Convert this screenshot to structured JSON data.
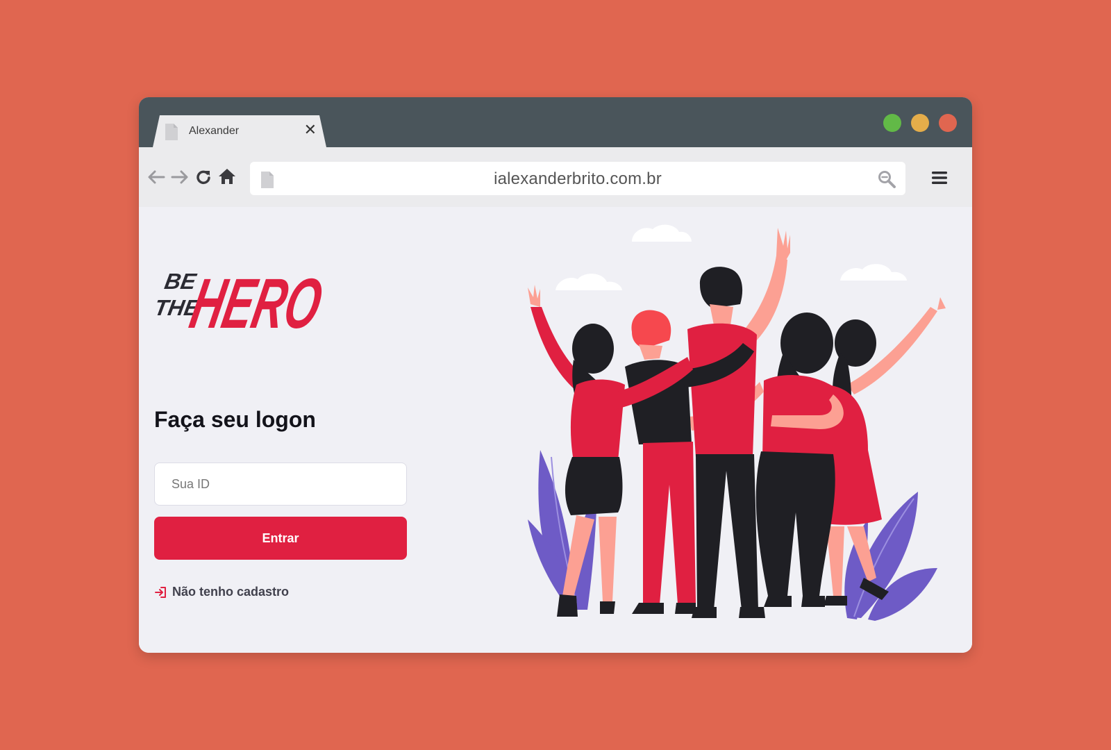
{
  "browser": {
    "tab": {
      "title": "Alexander",
      "close_label": "✕"
    },
    "window_controls": {
      "green": "#62b947",
      "yellow": "#e5ad4a",
      "red": "#e06650"
    },
    "address_bar": {
      "url": "ialexanderbrito.com.br"
    },
    "icons": [
      "file-icon",
      "close-icon",
      "back-arrow-icon",
      "forward-arrow-icon",
      "reload-icon",
      "home-icon",
      "search-icon",
      "hamburger-menu-icon"
    ]
  },
  "page": {
    "logo_text": {
      "line1": "BE",
      "line2": "THE",
      "word": "HERO"
    },
    "title": "Faça seu logon",
    "id_input": {
      "placeholder": "Sua ID",
      "value": ""
    },
    "submit_label": "Entrar",
    "register_link": "Não tenho cadastro",
    "colors": {
      "brand": "#e02041",
      "background": "#f0f0f5",
      "page_bg": "#e06650",
      "plant": "#6e5bc6"
    }
  }
}
